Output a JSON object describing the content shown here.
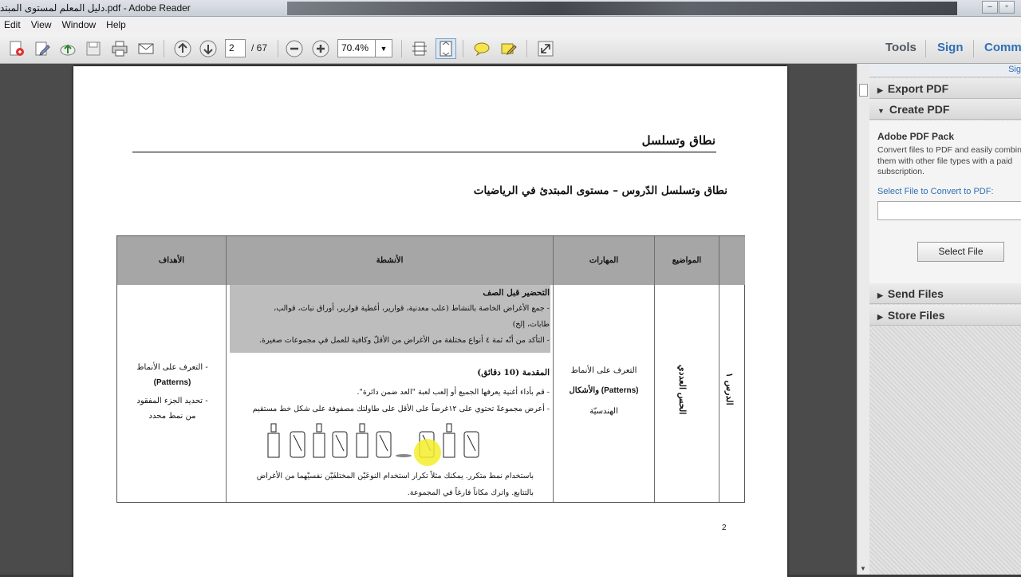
{
  "window": {
    "title": "دليل المعلم لمستوى المبتد.pdf - Adobe Reader",
    "controls": [
      "–",
      "▫",
      "✕"
    ]
  },
  "menu": [
    "Edit",
    "View",
    "Window",
    "Help"
  ],
  "toolbar": {
    "page_current": "2",
    "page_total": "/ 67",
    "zoom": "70.4%",
    "tools_label": "Tools",
    "sign_label": "Sign",
    "comment_label": "Comm"
  },
  "document": {
    "header": "نطاق وتسلسل",
    "subtitle": "نطاق وتسلسل الدّروس – مستوى المبتدئ في الرياضيات",
    "page_number": "2",
    "table": {
      "headers": {
        "objectives": "الأهداف",
        "activities": "الأنشطة",
        "skills": "المهارات",
        "topics": "المواضيع"
      },
      "lesson": "الدرس ١",
      "topic": "الحس العددي",
      "skills": [
        "التعرف على الأنماط",
        "(Patterns)  والأشكال",
        "الهندسيّة"
      ],
      "objectives": [
        "-    التعرف على الأنماط",
        "(Patterns)",
        "-    تحديد الجزء المفقود",
        "من نمط محدد"
      ],
      "prep_title": "التحضير قبل الصف",
      "prep_items": [
        "-   جمع الأغراض الخاصة بالنشاط (علب معدنية، قوارير، أغطية قوارير، أوراق نبات، قوالب،",
        "طابات، إلخ)",
        "-   التأكد من أنّه ثمة ٤ أنواع مختلفة من الأغراض من الأقلّ وكافية للعمل في مجموعات صغيرة."
      ],
      "intro_title": "المقدمة (10 دقائق)",
      "intro_items": [
        "-   قم بأداء أغنية يعرفها الجميع أو إلعب لعبة \"العد ضمن دائرة\".",
        "-   أعرض مجموعةً تحتوي على ١٢غرضاً على الأقل على طاولتك مصفوفة على شكل خط مستقيم"
      ],
      "intro_tail": [
        "باستخدام نمط متكرر. يمكنك مثلاً تكرار استخدام النوعَيْن المختلفَيْن نفسيْهما من الأغراض",
        "بالتتابع. واترك مكاناً فارغاً في المجموعة."
      ]
    }
  },
  "right_pane": {
    "top_link": "Sig",
    "export_pdf": "Export PDF",
    "create_pdf": "Create PDF",
    "pack_title": "Adobe PDF Pack",
    "pack_desc": "Convert files to PDF and easily combine them with other file types with a paid subscription.",
    "select_label": "Select File to Convert to PDF:",
    "select_button": "Select File",
    "send_files": "Send Files",
    "store_files": "Store Files"
  }
}
